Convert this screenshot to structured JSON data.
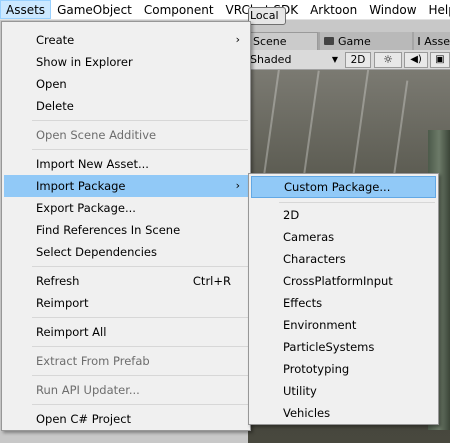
{
  "menubar": {
    "items": [
      "Assets",
      "GameObject",
      "Component",
      "VRChat SDK",
      "Arktoon",
      "Window",
      "Help"
    ]
  },
  "editor": {
    "local_button": "Local",
    "tabs": {
      "scene": "Scene",
      "game": "Game",
      "assets": "Asse"
    },
    "scene_toolbar": {
      "shading": "Shaded",
      "mode_2d": "2D",
      "lighting": "☼",
      "audio": "◀)",
      "fx": "▣"
    }
  },
  "assets_menu": {
    "items": [
      {
        "label": "Create",
        "has_submenu": true
      },
      {
        "label": "Show in Explorer"
      },
      {
        "label": "Open"
      },
      {
        "label": "Delete"
      },
      {
        "label": "Open Scene Additive",
        "disabled": true
      },
      {
        "label": "Import New Asset..."
      },
      {
        "label": "Import Package",
        "has_submenu": true,
        "highlighted": true
      },
      {
        "label": "Export Package..."
      },
      {
        "label": "Find References In Scene"
      },
      {
        "label": "Select Dependencies"
      },
      {
        "label": "Refresh",
        "shortcut": "Ctrl+R"
      },
      {
        "label": "Reimport"
      },
      {
        "label": "Reimport All"
      },
      {
        "label": "Extract From Prefab",
        "disabled": true
      },
      {
        "label": "Run API Updater...",
        "disabled": true
      },
      {
        "label": "Open C# Project"
      }
    ]
  },
  "import_package_menu": {
    "items": [
      {
        "label": "Custom Package...",
        "highlighted": true
      },
      {
        "label": "2D"
      },
      {
        "label": "Cameras"
      },
      {
        "label": "Characters"
      },
      {
        "label": "CrossPlatformInput"
      },
      {
        "label": "Effects"
      },
      {
        "label": "Environment"
      },
      {
        "label": "ParticleSystems"
      },
      {
        "label": "Prototyping"
      },
      {
        "label": "Utility"
      },
      {
        "label": "Vehicles"
      }
    ]
  },
  "colors": {
    "menu_bg": "#f0f0f0",
    "highlight": "#91c9f7",
    "disabled_text": "#6d6d6d",
    "menubar_active": "#cce8ff"
  }
}
